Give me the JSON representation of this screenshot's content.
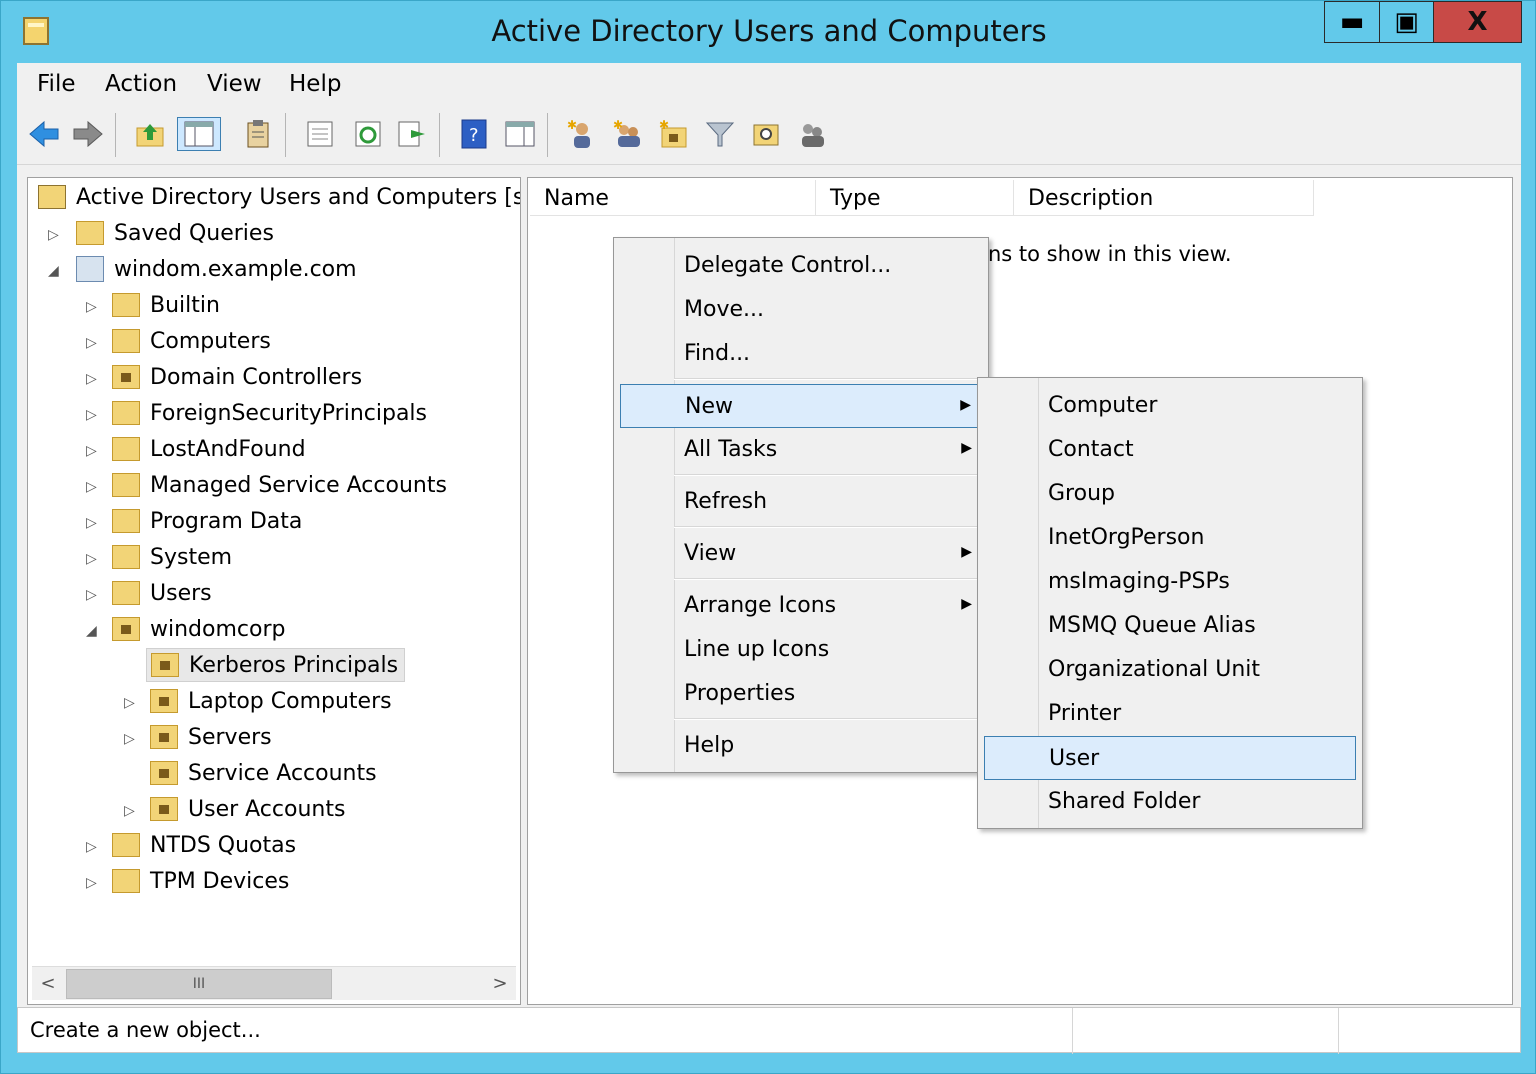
{
  "window": {
    "title": "Active Directory Users and Computers",
    "controls": {
      "minimize": "▬",
      "maximize": "▣",
      "close": "X"
    }
  },
  "menubar": [
    "File",
    "Action",
    "View",
    "Help"
  ],
  "toolbar_icons": [
    "back-icon",
    "forward-icon",
    "up-folder-icon",
    "show-console-tree-icon",
    "clipboard-icon",
    "properties-icon",
    "refresh-icon",
    "export-list-icon",
    "help-icon",
    "action-pane-icon",
    "new-user-icon",
    "new-group-icon",
    "new-ou-icon",
    "filter-icon",
    "find-icon",
    "add-to-group-icon"
  ],
  "tree": {
    "root": "Active Directory Users and Computers [svi",
    "items": [
      "Saved Queries",
      "windom.example.com",
      "Builtin",
      "Computers",
      "Domain Controllers",
      "ForeignSecurityPrincipals",
      "LostAndFound",
      "Managed Service Accounts",
      "Program Data",
      "System",
      "Users",
      "windomcorp",
      "Kerberos Principals",
      "Laptop Computers",
      "Servers",
      "Service Accounts",
      "User Accounts",
      "NTDS Quotas",
      "TPM Devices"
    ],
    "scrollbar_thumb": "III"
  },
  "list": {
    "columns": [
      "Name",
      "Type",
      "Description"
    ],
    "empty_message": "ns to show in this view."
  },
  "context_menu": {
    "items": [
      "Delegate Control...",
      "Move...",
      "Find...",
      "New",
      "All Tasks",
      "Refresh",
      "View",
      "Arrange Icons",
      "Line up Icons",
      "Properties",
      "Help"
    ]
  },
  "submenu_new": {
    "items": [
      "Computer",
      "Contact",
      "Group",
      "InetOrgPerson",
      "msImaging-PSPs",
      "MSMQ Queue Alias",
      "Organizational Unit",
      "Printer",
      "User",
      "Shared Folder"
    ]
  },
  "status": {
    "text": "Create a new object..."
  },
  "colors": {
    "titlebar": "#62c9ea",
    "close_button": "#c84a47",
    "highlight": "#dcecfc",
    "highlight_border": "#3c7fb1"
  }
}
